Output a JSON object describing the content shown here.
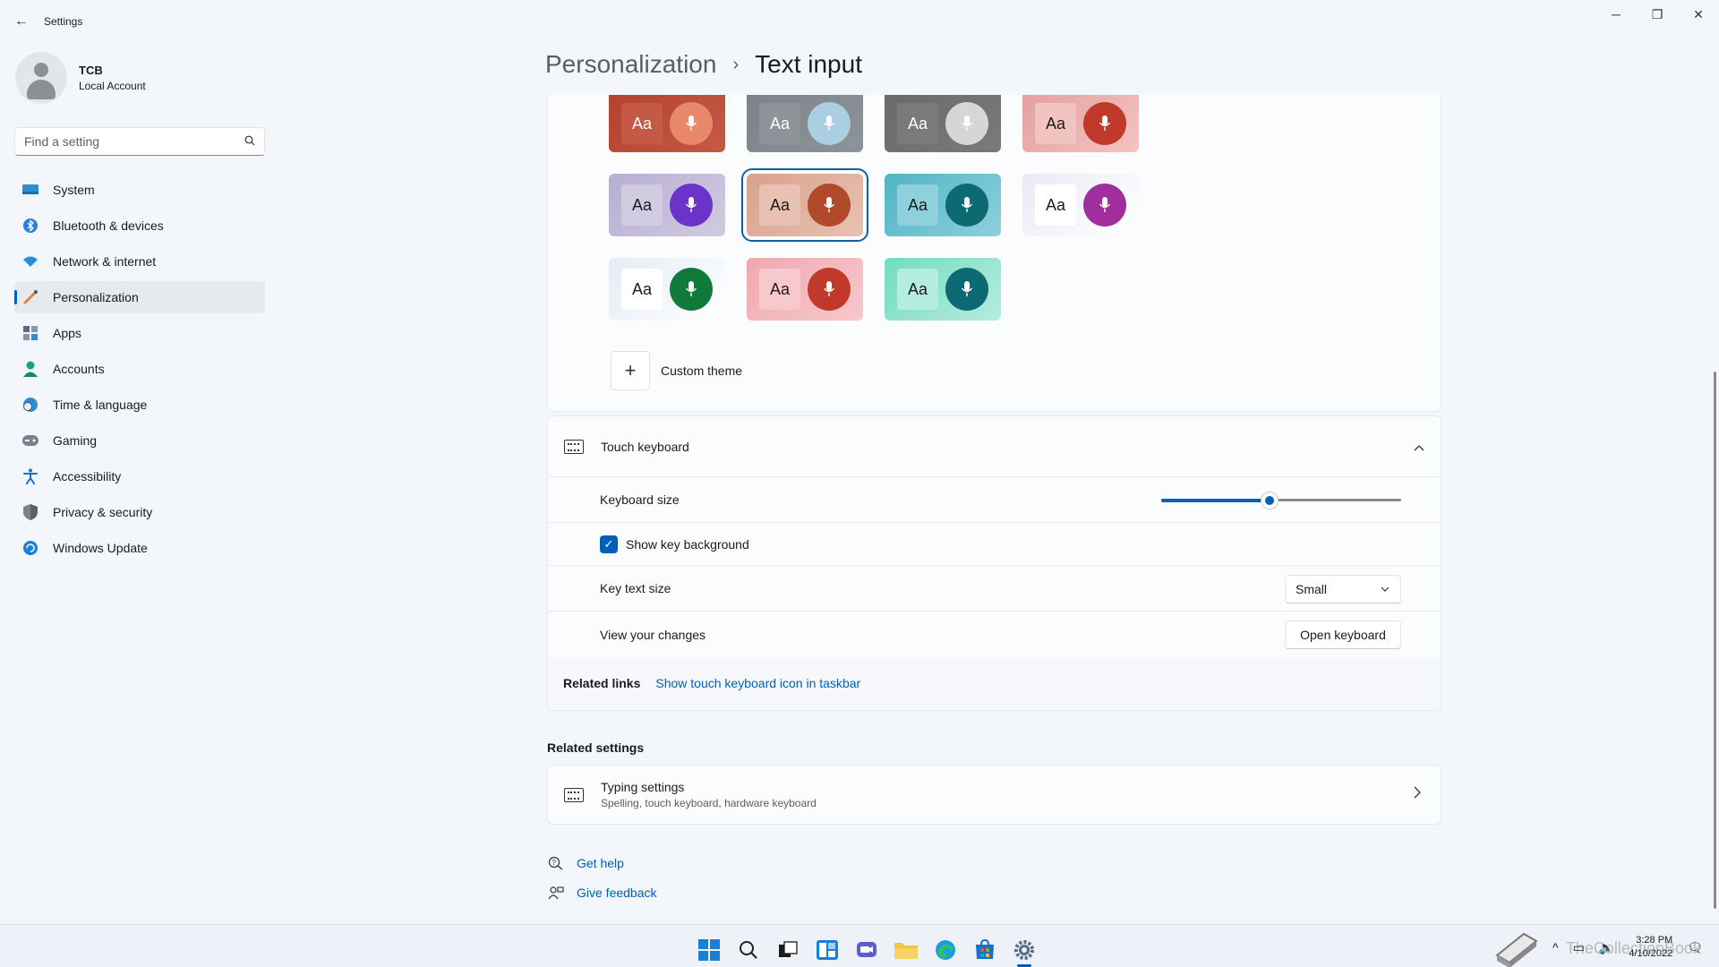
{
  "window": {
    "title": "Settings",
    "controls": [
      "minimize",
      "restore",
      "close"
    ]
  },
  "profile": {
    "name": "TCB",
    "account_type": "Local Account"
  },
  "search": {
    "placeholder": "Find a setting"
  },
  "sidebar": {
    "items": [
      {
        "label": "System",
        "icon": "system-icon",
        "active": false
      },
      {
        "label": "Bluetooth & devices",
        "icon": "bluetooth-icon",
        "active": false
      },
      {
        "label": "Network & internet",
        "icon": "wifi-icon",
        "active": false
      },
      {
        "label": "Personalization",
        "icon": "brush-icon",
        "active": true
      },
      {
        "label": "Apps",
        "icon": "apps-icon",
        "active": false
      },
      {
        "label": "Accounts",
        "icon": "accounts-icon",
        "active": false
      },
      {
        "label": "Time & language",
        "icon": "clock-globe-icon",
        "active": false
      },
      {
        "label": "Gaming",
        "icon": "gamepad-icon",
        "active": false
      },
      {
        "label": "Accessibility",
        "icon": "accessibility-icon",
        "active": false
      },
      {
        "label": "Privacy & security",
        "icon": "shield-icon",
        "active": false
      },
      {
        "label": "Windows Update",
        "icon": "update-icon",
        "active": false
      }
    ]
  },
  "breadcrumb": {
    "parent": "Personalization",
    "separator": "›",
    "current": "Text input"
  },
  "themes": {
    "aa_label": "Aa",
    "tiles": [
      {
        "bg": "#b4412e",
        "aa_bg": "#c45a46",
        "aa_fg": "#ffffff",
        "mic_bg": "#e8876a"
      },
      {
        "bg": "#7d8389",
        "aa_bg": "#8e9399",
        "aa_fg": "#ffffff",
        "mic_bg": "#a9cfe0"
      },
      {
        "bg": "#6a6a6a",
        "aa_bg": "#7a7a7a",
        "aa_fg": "#ffffff",
        "mic_bg": "#d6d6d6"
      },
      {
        "bg": "#e6a0a0",
        "aa_bg": "#f2c4c0",
        "aa_fg": "#1b1b1b",
        "mic_bg": "#c0392b"
      },
      {
        "bg": "#b7aed0",
        "aa_bg": "#d1cbe2",
        "aa_fg": "#1b1b1b",
        "mic_bg": "#6b33c9"
      },
      {
        "bg": "#d9a28c",
        "aa_bg": "#e9c1b2",
        "aa_fg": "#1b1b1b",
        "mic_bg": "#b04a2a",
        "selected": true
      },
      {
        "bg": "#4fb4c6",
        "aa_bg": "#8ed0dc",
        "aa_fg": "#1b1b1b",
        "mic_bg": "#0e6a72"
      },
      {
        "bg": "#e9eaf6",
        "aa_bg": "#ffffff",
        "aa_fg": "#1b1b1b",
        "mic_bg": "#a02e9c"
      },
      {
        "bg": "#e4ecf6",
        "aa_bg": "#ffffff",
        "aa_fg": "#1b1b1b",
        "mic_bg": "#0f7a3a"
      },
      {
        "bg": "#f0a8b0",
        "aa_bg": "#f7c8cc",
        "aa_fg": "#1b1b1b",
        "mic_bg": "#c0392b"
      },
      {
        "bg": "#72dcc0",
        "aa_bg": "#b4ecde",
        "aa_fg": "#1b1b1b",
        "mic_bg": "#0e6a72"
      }
    ],
    "custom_label": "Custom theme"
  },
  "touch_keyboard": {
    "title": "Touch keyboard",
    "keyboard_size_label": "Keyboard size",
    "keyboard_size_value": 0.45,
    "show_key_background_label": "Show key background",
    "show_key_background_checked": true,
    "key_text_size_label": "Key text size",
    "key_text_size_value": "Small",
    "view_changes_label": "View your changes",
    "open_keyboard_label": "Open keyboard",
    "related_links_label": "Related links",
    "related_link": "Show touch keyboard icon in taskbar"
  },
  "related_settings": {
    "title": "Related settings",
    "typing_title": "Typing settings",
    "typing_sub": "Spelling, touch keyboard, hardware keyboard"
  },
  "help": {
    "get_help": "Get help",
    "give_feedback": "Give feedback"
  },
  "taskbar": {
    "icons": [
      "windows-start-icon",
      "search-icon",
      "task-view-icon",
      "widgets-icon",
      "chat-icon",
      "file-explorer-icon",
      "edge-icon",
      "store-icon",
      "settings-icon"
    ],
    "time": "3:28 PM",
    "date": "4/10/2022",
    "watermark": "TheCollectionBook"
  },
  "colors": {
    "accent": "#005fb8",
    "background": "#f3f6fb"
  }
}
